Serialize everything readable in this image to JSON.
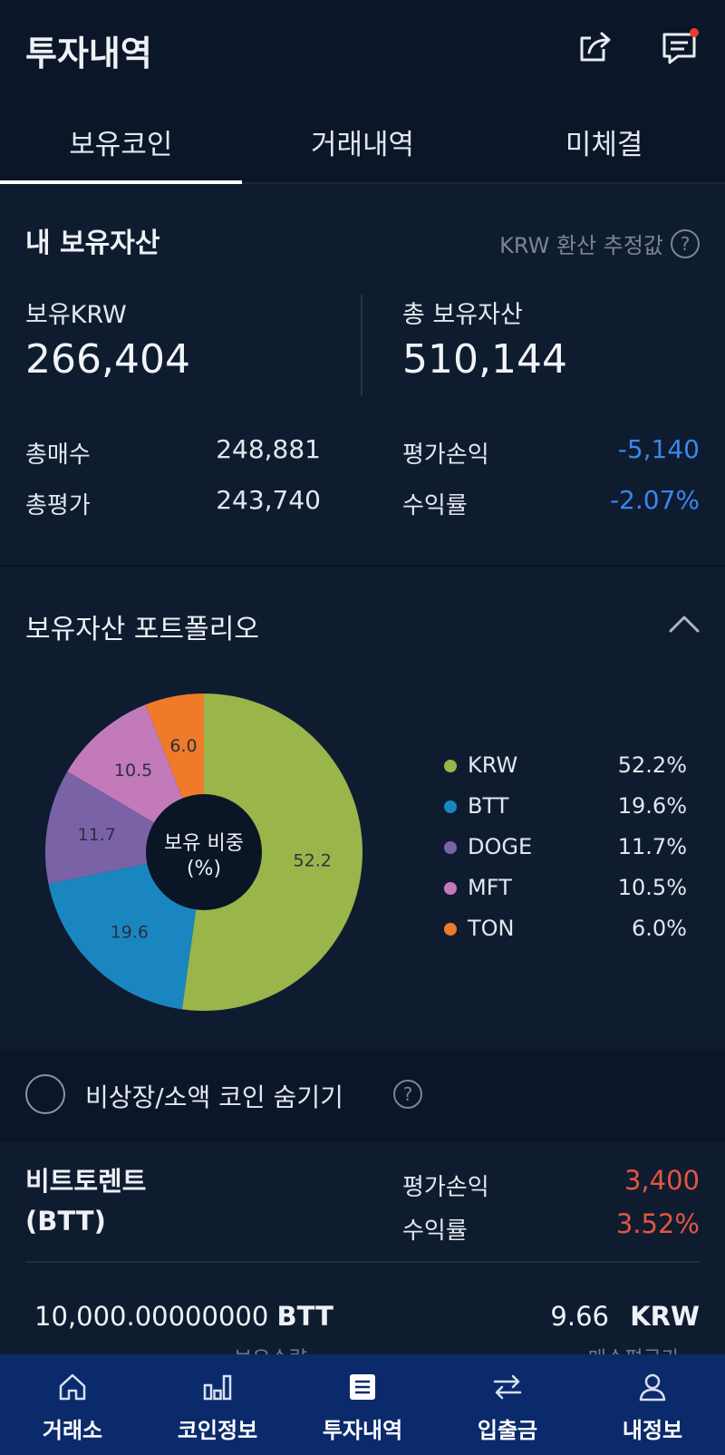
{
  "header": {
    "title": "투자내역"
  },
  "tabs": [
    {
      "label": "보유코인",
      "active": true
    },
    {
      "label": "거래내역",
      "active": false
    },
    {
      "label": "미체결",
      "active": false
    }
  ],
  "assets": {
    "title": "내 보유자산",
    "krw_note": "KRW 환산 추정값",
    "held_krw_label": "보유KRW",
    "held_krw_value": "266,404",
    "total_label": "총 보유자산",
    "total_value": "510,144",
    "total_buy_label": "총매수",
    "total_buy_value": "248,881",
    "total_eval_label": "총평가",
    "total_eval_value": "243,740",
    "pnl_label": "평가손익",
    "pnl_value": "-5,140",
    "return_label": "수익률",
    "return_value": "-2.07%"
  },
  "portfolio": {
    "title": "보유자산 포트폴리오",
    "center_label_line1": "보유 비중",
    "center_label_line2": "(%)",
    "chart_data": {
      "type": "pie",
      "categories": [
        "KRW",
        "BTT",
        "DOGE",
        "MFT",
        "TON"
      ],
      "values": [
        52.2,
        19.6,
        11.7,
        10.5,
        6.0
      ],
      "slice_labels": [
        "52.2",
        "19.6",
        "11.7",
        "10.5",
        "6.0"
      ],
      "legend_values": [
        "52.2%",
        "19.6%",
        "11.7%",
        "10.5%",
        "6.0%"
      ],
      "colors": [
        "#9ab54a",
        "#1a86c0",
        "#7a62a6",
        "#c27aba",
        "#f07a2a"
      ],
      "legend_position": "right"
    }
  },
  "hide_coins": {
    "label": "비상장/소액 코인 숨기기"
  },
  "coin": {
    "name_line1": "비트토렌트",
    "name_line2": "(BTT)",
    "pnl_label": "평가손익",
    "pnl_value": "3,400",
    "return_label": "수익률",
    "return_value": "3.52%",
    "quantity_number": "10,000.00000000",
    "quantity_unit": "BTT",
    "avg_price_number": "9.66",
    "avg_price_unit": "KRW",
    "quantity_caption": "보유수량",
    "avg_price_caption": "매수평균가"
  },
  "nav": [
    {
      "label": "거래소",
      "icon": "home-icon"
    },
    {
      "label": "코인정보",
      "icon": "bar-chart-icon"
    },
    {
      "label": "투자내역",
      "icon": "document-icon"
    },
    {
      "label": "입출금",
      "icon": "transfer-icon"
    },
    {
      "label": "내정보",
      "icon": "user-icon"
    }
  ]
}
